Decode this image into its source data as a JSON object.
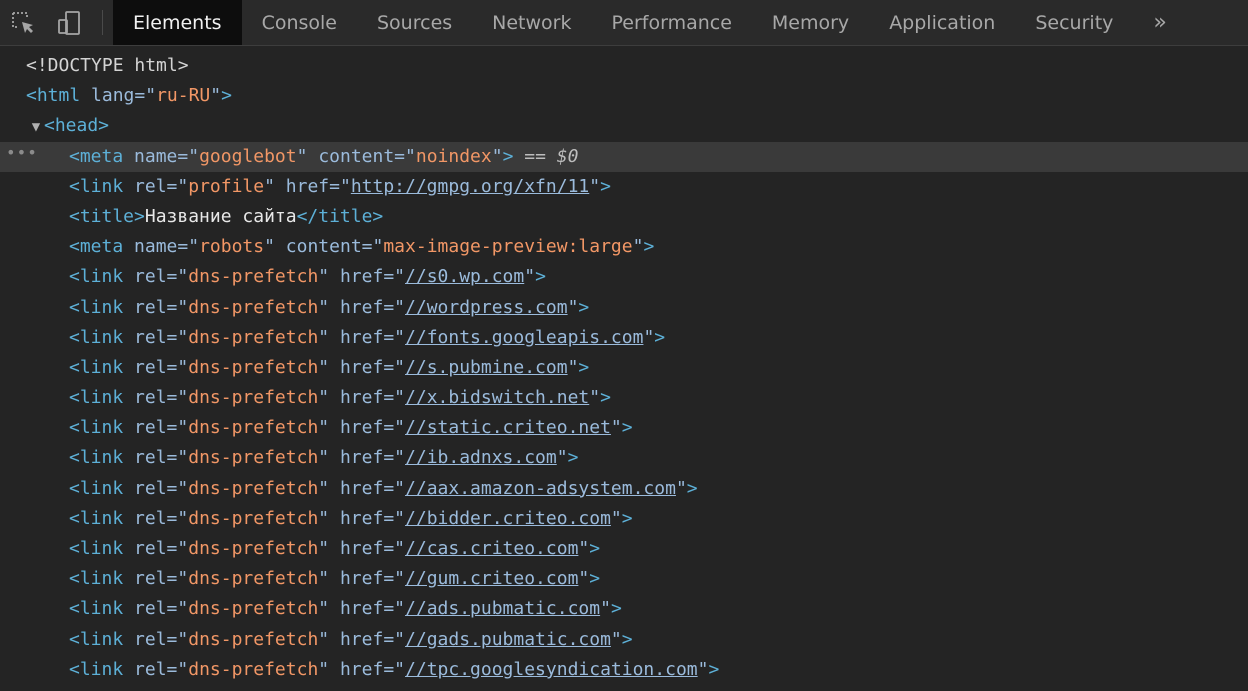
{
  "toolbar": {
    "inspect_icon": "inspect-element-icon",
    "device_icon": "device-toolbar-icon",
    "tabs": [
      {
        "label": "Elements",
        "active": true
      },
      {
        "label": "Console"
      },
      {
        "label": "Sources"
      },
      {
        "label": "Network"
      },
      {
        "label": "Performance"
      },
      {
        "label": "Memory"
      },
      {
        "label": "Application"
      },
      {
        "label": "Security"
      }
    ],
    "more_label": "»"
  },
  "dom": {
    "doctype": "<!DOCTYPE html>",
    "html_lang": "ru-RU",
    "selected_ref": "== $0",
    "meta_googlebot": {
      "name": "googlebot",
      "content": "noindex"
    },
    "link_profile": {
      "rel": "profile",
      "href": "http://gmpg.org/xfn/11"
    },
    "title_text": "Название сайта",
    "meta_robots": {
      "name": "robots",
      "content": "max-image-preview:large"
    },
    "dns_prefetch_rel": "dns-prefetch",
    "dns_prefetch": [
      "//s0.wp.com",
      "//wordpress.com",
      "//fonts.googleapis.com",
      "//s.pubmine.com",
      "//x.bidswitch.net",
      "//static.criteo.net",
      "//ib.adnxs.com",
      "//aax.amazon-adsystem.com",
      "//bidder.criteo.com",
      "//cas.criteo.com",
      "//gum.criteo.com",
      "//ads.pubmatic.com",
      "//gads.pubmatic.com",
      "//tpc.googlesyndication.com"
    ]
  },
  "colors": {
    "tag": "#5db0d7",
    "attr_name": "#9bbbdc",
    "attr_value": "#f29766",
    "active_tab_bg": "#0d0d0d",
    "panel_bg": "#242424"
  }
}
